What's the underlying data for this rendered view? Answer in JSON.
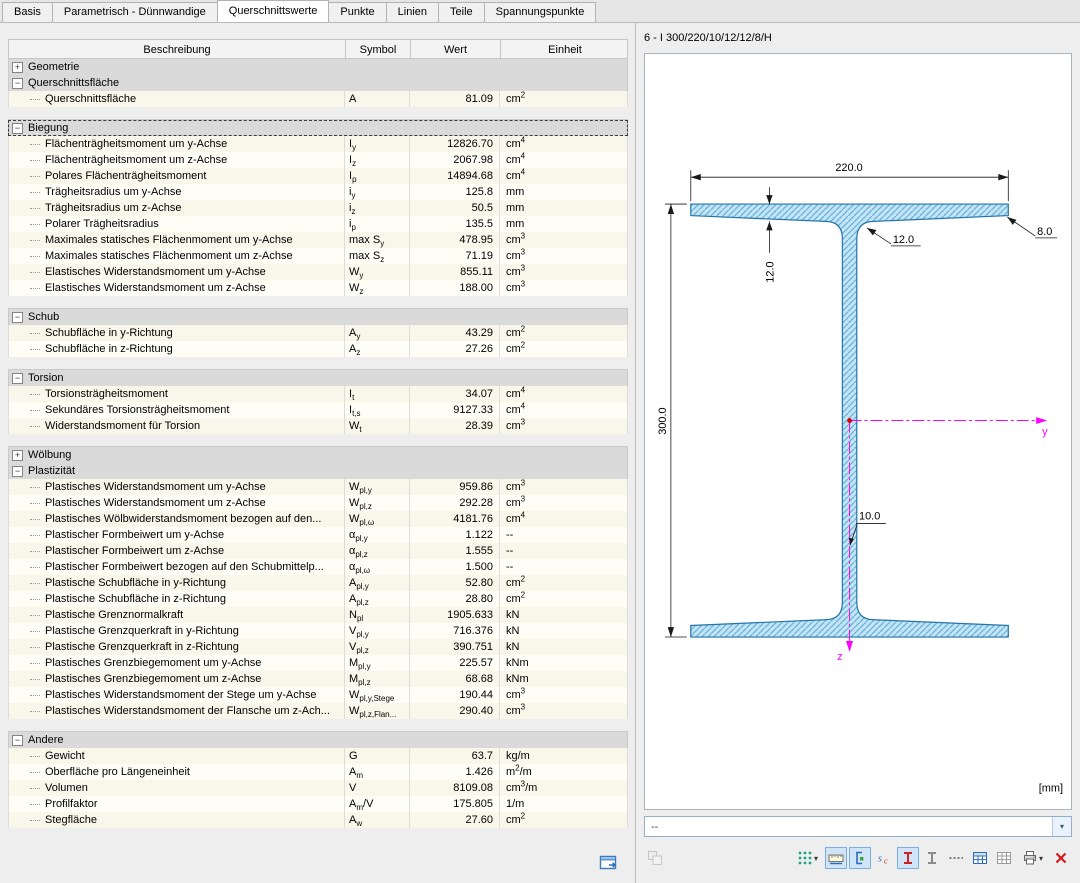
{
  "tabs": {
    "items": [
      {
        "label": "Basis",
        "active": false
      },
      {
        "label": "Parametrisch - Dünnwandige",
        "active": false
      },
      {
        "label": "Querschnittswerte",
        "active": true
      },
      {
        "label": "Punkte",
        "active": false
      },
      {
        "label": "Linien",
        "active": false
      },
      {
        "label": "Teile",
        "active": false
      },
      {
        "label": "Spannungspunkte",
        "active": false
      }
    ]
  },
  "table": {
    "headers": [
      "Beschreibung",
      "Symbol",
      "Wert",
      "Einheit"
    ],
    "sections": [
      {
        "label": "Geometrie",
        "expanded": false,
        "selected": false,
        "gap_after": false,
        "rows": []
      },
      {
        "label": "Querschnittsfläche",
        "expanded": true,
        "selected": false,
        "gap_after": true,
        "rows": [
          {
            "d": "Querschnittsfläche",
            "s": [
              [
                "A",
                0
              ]
            ],
            "v": "81.09",
            "u": [
              [
                "cm",
                0
              ],
              [
                "2",
                2
              ]
            ]
          }
        ]
      },
      {
        "label": "Biegung",
        "expanded": true,
        "selected": true,
        "gap_after": true,
        "rows": [
          {
            "d": "Flächenträgheitsmoment um y-Achse",
            "s": [
              [
                "I",
                0
              ],
              [
                "y",
                1
              ]
            ],
            "v": "12826.70",
            "u": [
              [
                "cm",
                0
              ],
              [
                "4",
                2
              ]
            ]
          },
          {
            "d": "Flächenträgheitsmoment um z-Achse",
            "s": [
              [
                "I",
                0
              ],
              [
                "z",
                1
              ]
            ],
            "v": "2067.98",
            "u": [
              [
                "cm",
                0
              ],
              [
                "4",
                2
              ]
            ]
          },
          {
            "d": "Polares Flächenträgheitsmoment",
            "s": [
              [
                "I",
                0
              ],
              [
                "p",
                1
              ]
            ],
            "v": "14894.68",
            "u": [
              [
                "cm",
                0
              ],
              [
                "4",
                2
              ]
            ]
          },
          {
            "d": "Trägheitsradius um y-Achse",
            "s": [
              [
                "i",
                0
              ],
              [
                "y",
                1
              ]
            ],
            "v": "125.8",
            "u": [
              [
                "mm",
                0
              ]
            ]
          },
          {
            "d": "Trägheitsradius um z-Achse",
            "s": [
              [
                "i",
                0
              ],
              [
                "z",
                1
              ]
            ],
            "v": "50.5",
            "u": [
              [
                "mm",
                0
              ]
            ]
          },
          {
            "d": "Polarer Trägheitsradius",
            "s": [
              [
                "i",
                0
              ],
              [
                "p",
                1
              ]
            ],
            "v": "135.5",
            "u": [
              [
                "mm",
                0
              ]
            ]
          },
          {
            "d": "Maximales statisches Flächenmoment um y-Achse",
            "s": [
              [
                "max S",
                0
              ],
              [
                "y",
                1
              ]
            ],
            "v": "478.95",
            "u": [
              [
                "cm",
                0
              ],
              [
                "3",
                2
              ]
            ]
          },
          {
            "d": "Maximales statisches Flächenmoment um z-Achse",
            "s": [
              [
                "max S",
                0
              ],
              [
                "z",
                1
              ]
            ],
            "v": "71.19",
            "u": [
              [
                "cm",
                0
              ],
              [
                "3",
                2
              ]
            ]
          },
          {
            "d": "Elastisches Widerstandsmoment um y-Achse",
            "s": [
              [
                "W",
                0
              ],
              [
                "y",
                1
              ]
            ],
            "v": "855.11",
            "u": [
              [
                "cm",
                0
              ],
              [
                "3",
                2
              ]
            ]
          },
          {
            "d": "Elastisches Widerstandsmoment um z-Achse",
            "s": [
              [
                "W",
                0
              ],
              [
                "z",
                1
              ]
            ],
            "v": "188.00",
            "u": [
              [
                "cm",
                0
              ],
              [
                "3",
                2
              ]
            ]
          }
        ]
      },
      {
        "label": "Schub",
        "expanded": true,
        "selected": false,
        "gap_after": true,
        "rows": [
          {
            "d": "Schubfläche in y-Richtung",
            "s": [
              [
                "A",
                0
              ],
              [
                "y",
                1
              ]
            ],
            "v": "43.29",
            "u": [
              [
                "cm",
                0
              ],
              [
                "2",
                2
              ]
            ]
          },
          {
            "d": "Schubfläche in z-Richtung",
            "s": [
              [
                "A",
                0
              ],
              [
                "z",
                1
              ]
            ],
            "v": "27.26",
            "u": [
              [
                "cm",
                0
              ],
              [
                "2",
                2
              ]
            ]
          }
        ]
      },
      {
        "label": "Torsion",
        "expanded": true,
        "selected": false,
        "gap_after": true,
        "rows": [
          {
            "d": "Torsionsträgheitsmoment",
            "s": [
              [
                "I",
                0
              ],
              [
                "t",
                1
              ]
            ],
            "v": "34.07",
            "u": [
              [
                "cm",
                0
              ],
              [
                "4",
                2
              ]
            ]
          },
          {
            "d": "Sekundäres Torsionsträgheitsmoment",
            "s": [
              [
                "I",
                0
              ],
              [
                "t,s",
                1
              ]
            ],
            "v": "9127.33",
            "u": [
              [
                "cm",
                0
              ],
              [
                "4",
                2
              ]
            ]
          },
          {
            "d": "Widerstandsmoment für Torsion",
            "s": [
              [
                "W",
                0
              ],
              [
                "t",
                1
              ]
            ],
            "v": "28.39",
            "u": [
              [
                "cm",
                0
              ],
              [
                "3",
                2
              ]
            ]
          }
        ]
      },
      {
        "label": "Wölbung",
        "expanded": false,
        "selected": false,
        "gap_after": false,
        "rows": []
      },
      {
        "label": "Plastizität",
        "expanded": true,
        "selected": false,
        "gap_after": true,
        "rows": [
          {
            "d": "Plastisches Widerstandsmoment um y-Achse",
            "s": [
              [
                "W",
                0
              ],
              [
                "pl,y",
                1
              ]
            ],
            "v": "959.86",
            "u": [
              [
                "cm",
                0
              ],
              [
                "3",
                2
              ]
            ]
          },
          {
            "d": "Plastisches Widerstandsmoment um z-Achse",
            "s": [
              [
                "W",
                0
              ],
              [
                "pl,z",
                1
              ]
            ],
            "v": "292.28",
            "u": [
              [
                "cm",
                0
              ],
              [
                "3",
                2
              ]
            ]
          },
          {
            "d": "Plastisches Wölbwiderstandsmoment bezogen auf den...",
            "s": [
              [
                "W",
                0
              ],
              [
                "pl,ω",
                1
              ]
            ],
            "v": "4181.76",
            "u": [
              [
                "cm",
                0
              ],
              [
                "4",
                2
              ]
            ]
          },
          {
            "d": "Plastischer Formbeiwert um y-Achse",
            "s": [
              [
                "α",
                0
              ],
              [
                "pl,y",
                1
              ]
            ],
            "v": "1.122",
            "u": [
              [
                "--",
                0
              ]
            ]
          },
          {
            "d": "Plastischer Formbeiwert um z-Achse",
            "s": [
              [
                "α",
                0
              ],
              [
                "pl,z",
                1
              ]
            ],
            "v": "1.555",
            "u": [
              [
                "--",
                0
              ]
            ]
          },
          {
            "d": "Plastischer Formbeiwert bezogen auf den Schubmittelp...",
            "s": [
              [
                "α",
                0
              ],
              [
                "pl,ω",
                1
              ]
            ],
            "v": "1.500",
            "u": [
              [
                "--",
                0
              ]
            ]
          },
          {
            "d": "Plastische Schubfläche in y-Richtung",
            "s": [
              [
                "A",
                0
              ],
              [
                "pl,y",
                1
              ]
            ],
            "v": "52.80",
            "u": [
              [
                "cm",
                0
              ],
              [
                "2",
                2
              ]
            ]
          },
          {
            "d": "Plastische Schubfläche in z-Richtung",
            "s": [
              [
                "A",
                0
              ],
              [
                "pl,z",
                1
              ]
            ],
            "v": "28.80",
            "u": [
              [
                "cm",
                0
              ],
              [
                "2",
                2
              ]
            ]
          },
          {
            "d": "Plastische Grenznormalkraft",
            "s": [
              [
                "N",
                0
              ],
              [
                "pl",
                1
              ]
            ],
            "v": "1905.633",
            "u": [
              [
                "kN",
                0
              ]
            ]
          },
          {
            "d": "Plastische Grenzquerkraft in y-Richtung",
            "s": [
              [
                "V",
                0
              ],
              [
                "pl,y",
                1
              ]
            ],
            "v": "716.376",
            "u": [
              [
                "kN",
                0
              ]
            ]
          },
          {
            "d": "Plastische Grenzquerkraft in z-Richtung",
            "s": [
              [
                "V",
                0
              ],
              [
                "pl,z",
                1
              ]
            ],
            "v": "390.751",
            "u": [
              [
                "kN",
                0
              ]
            ]
          },
          {
            "d": "Plastisches Grenzbiegemoment um y-Achse",
            "s": [
              [
                "M",
                0
              ],
              [
                "pl,y",
                1
              ]
            ],
            "v": "225.57",
            "u": [
              [
                "kNm",
                0
              ]
            ]
          },
          {
            "d": "Plastisches Grenzbiegemoment um z-Achse",
            "s": [
              [
                "M",
                0
              ],
              [
                "pl,z",
                1
              ]
            ],
            "v": "68.68",
            "u": [
              [
                "kNm",
                0
              ]
            ]
          },
          {
            "d": "Plastisches Widerstandsmoment der Stege um y-Achse",
            "s": [
              [
                "W",
                0
              ],
              [
                "pl,y,Stege",
                1
              ]
            ],
            "v": "190.44",
            "u": [
              [
                "cm",
                0
              ],
              [
                "3",
                2
              ]
            ]
          },
          {
            "d": "Plastisches Widerstandsmoment der Flansche um z-Ach...",
            "s": [
              [
                "W",
                0
              ],
              [
                "pl,z,Flan...",
                1
              ]
            ],
            "v": "290.40",
            "u": [
              [
                "cm",
                0
              ],
              [
                "3",
                2
              ]
            ]
          }
        ]
      },
      {
        "label": "Andere",
        "expanded": true,
        "selected": false,
        "gap_after": false,
        "rows": [
          {
            "d": "Gewicht",
            "s": [
              [
                "G",
                0
              ]
            ],
            "v": "63.7",
            "u": [
              [
                "kg/m",
                0
              ]
            ]
          },
          {
            "d": "Oberfläche pro Längeneinheit",
            "s": [
              [
                "A",
                0
              ],
              [
                "m",
                1
              ]
            ],
            "v": "1.426",
            "u": [
              [
                "m",
                0
              ],
              [
                "2",
                2
              ],
              [
                "/m",
                0
              ]
            ]
          },
          {
            "d": "Volumen",
            "s": [
              [
                "V",
                0
              ]
            ],
            "v": "8109.08",
            "u": [
              [
                "cm",
                0
              ],
              [
                "3",
                2
              ],
              [
                "/m",
                0
              ]
            ]
          },
          {
            "d": "Profilfaktor",
            "s": [
              [
                "A",
                0
              ],
              [
                "m",
                1
              ],
              [
                "/V",
                0
              ]
            ],
            "v": "175.805",
            "u": [
              [
                "1/m",
                0
              ]
            ]
          },
          {
            "d": "Stegfläche",
            "s": [
              [
                "A",
                0
              ],
              [
                "w",
                1
              ]
            ],
            "v": "27.60",
            "u": [
              [
                "cm",
                0
              ],
              [
                "2",
                2
              ]
            ]
          }
        ]
      }
    ]
  },
  "graphic": {
    "title": "6 - I 300/220/10/12/12/8/H",
    "units_label": "[mm]",
    "dropdown_value": "--",
    "dims": {
      "width": "220.0",
      "height": "300.0",
      "flange": "12.0",
      "fillet": "12.0",
      "tip": "8.0",
      "web": "10.0"
    },
    "axes": {
      "y": "y",
      "z": "z"
    },
    "colors": {
      "section_fill": "#c2e4f5",
      "section_line": "#2475a8",
      "axis": "#ff00ff",
      "centroid": "#e00000"
    }
  },
  "left_footer": {
    "buttons": [
      {
        "name": "export-table-button",
        "icon": "window-export-icon"
      }
    ]
  },
  "graphic_toolbar": {
    "left_buttons": [
      {
        "name": "copy-graphic-button",
        "icon": "copy-icon",
        "disabled": true
      }
    ],
    "right_buttons": [
      {
        "name": "point-display-button",
        "icon": "dots-grid-icon",
        "dropdown": true
      },
      {
        "name": "dimensions-toggle-button",
        "icon": "ruler-icon",
        "active": true
      },
      {
        "name": "outline-toggle-button",
        "icon": "bracket-icon",
        "active": true
      },
      {
        "name": "shear-center-toggle-button",
        "icon": "sc-icon"
      },
      {
        "name": "principal-axes-button",
        "icon": "ibeam-red-icon",
        "active": true
      },
      {
        "name": "input-axes-button",
        "icon": "ibeam-gray-icon"
      },
      {
        "name": "hidden-lines-button",
        "icon": "dotted-line-icon"
      },
      {
        "name": "numbering-button",
        "icon": "grid-blue-icon"
      },
      {
        "name": "grid-toggle-button",
        "icon": "grid-gray-icon"
      },
      {
        "name": "print-graphic-button",
        "icon": "printer-icon",
        "dropdown": true
      },
      {
        "name": "close-graphic-button",
        "icon": "red-x-icon"
      }
    ]
  }
}
